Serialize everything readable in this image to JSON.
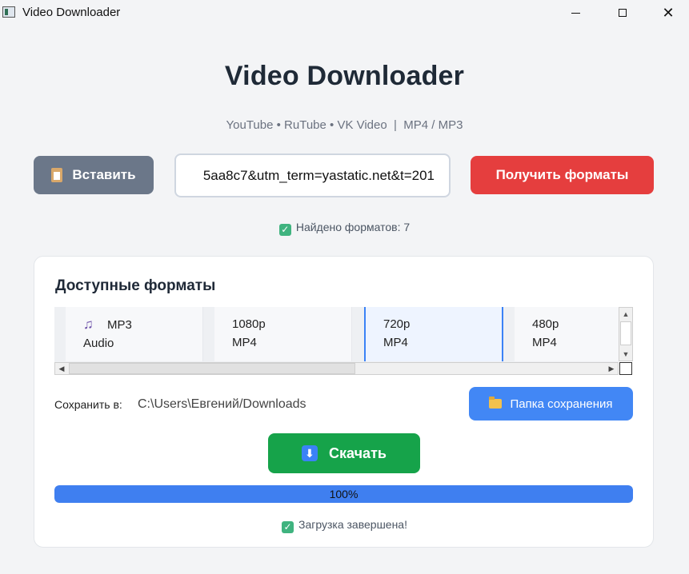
{
  "window": {
    "title": "Video Downloader",
    "controls": [
      "minimize",
      "maximize",
      "close"
    ]
  },
  "header": {
    "title": "Video Downloader",
    "subtitle": "YouTube • RuTube • VK Video  |  MP4 / MP3"
  },
  "toolbar": {
    "paste_label": "Вставить",
    "url_value": "5aa8c7&utm_term=yastatic.net&t=201",
    "get_formats_label": "Получить форматы"
  },
  "status": {
    "found_text": "Найдено форматов: 7"
  },
  "formats": {
    "title": "Доступные форматы",
    "items": [
      {
        "quality": "MP3",
        "type": "Audio",
        "icon": "music-note-icon"
      },
      {
        "quality": "1080p",
        "type": "MP4"
      },
      {
        "quality": "720p",
        "type": "MP4",
        "selected": true
      },
      {
        "quality": "480p",
        "type": "MP4"
      }
    ]
  },
  "save": {
    "label": "Сохранить в:",
    "path": "C:\\Users\\Евгений/Downloads",
    "folder_button_label": "Папка сохранения"
  },
  "download": {
    "button_label": "Скачать",
    "progress": 100,
    "progress_text": "100%",
    "complete_text": "Загрузка завершена!"
  },
  "colors": {
    "paste_button": "#6b7789",
    "get_formats_button": "#e53e3e",
    "folder_button": "#4287f5",
    "download_button": "#16a34a",
    "progress_fill": "#3f7ff0",
    "selected_format_border": "#3b82f6"
  }
}
